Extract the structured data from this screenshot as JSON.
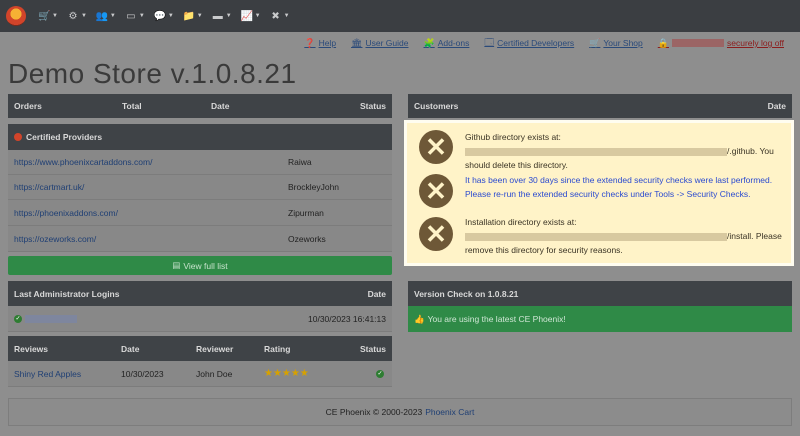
{
  "topnav": {
    "icons": [
      "cart-icon",
      "gears-icon",
      "users-icon",
      "modules-icon",
      "chat-icon",
      "folder-icon",
      "tools-icon",
      "reports-icon",
      "wrench-icon"
    ]
  },
  "toplinks": {
    "help": "Help",
    "user_guide": "User Guide",
    "addons": "Add-ons",
    "certified_developers": "Certified Developers",
    "your_shop": "Your Shop",
    "logoff": "securely log off"
  },
  "page_title": "Demo Store v.1.0.8.21",
  "orders": {
    "headers": [
      "Orders",
      "Total",
      "Date",
      "Status"
    ]
  },
  "certified": {
    "title": "Certified Providers",
    "rows": [
      {
        "url": "https://www.phoenixcartaddons.com/",
        "name": "Raiwa"
      },
      {
        "url": "https://cartmart.uk/",
        "name": "BrockleyJohn"
      },
      {
        "url": "https://phoenixaddons.com/",
        "name": "Zipurman"
      },
      {
        "url": "https://ozeworks.com/",
        "name": "Ozeworks"
      }
    ],
    "view_full": "View full list"
  },
  "admin_logins": {
    "headers": [
      "Last Administrator Logins",
      "Date"
    ],
    "rows": [
      {
        "date": "10/30/2023 16:41:13"
      }
    ]
  },
  "reviews": {
    "headers": [
      "Reviews",
      "Date",
      "Reviewer",
      "Rating",
      "Status"
    ],
    "rows": [
      {
        "product": "Shiny Red Apples",
        "date": "10/30/2023",
        "reviewer": "John Doe",
        "rating": 5
      }
    ]
  },
  "customers": {
    "headers": [
      "Customers",
      "Date"
    ]
  },
  "alerts": [
    {
      "line1": "Github directory exists at:",
      "suffix": "/.github. You",
      "line2": "should delete this directory."
    },
    {
      "line1": "It has been over 30 days since the extended security checks were last performed.",
      "line2": "Please re-run the extended security checks under Tools -> Security Checks."
    },
    {
      "line1": "Installation directory exists at:",
      "suffix": "/install. Please",
      "line2": "remove this directory for security reasons."
    }
  ],
  "version": {
    "title": "Version Check on 1.0.8.21",
    "message": "You are using the latest CE Phoenix!"
  },
  "footer": {
    "text": "CE Phoenix © 2000-2023",
    "link": "Phoenix Cart"
  },
  "colors": {
    "accent_green": "#2f8a47",
    "header_dark": "#3f4347",
    "alert_bg": "#fff3c8"
  }
}
